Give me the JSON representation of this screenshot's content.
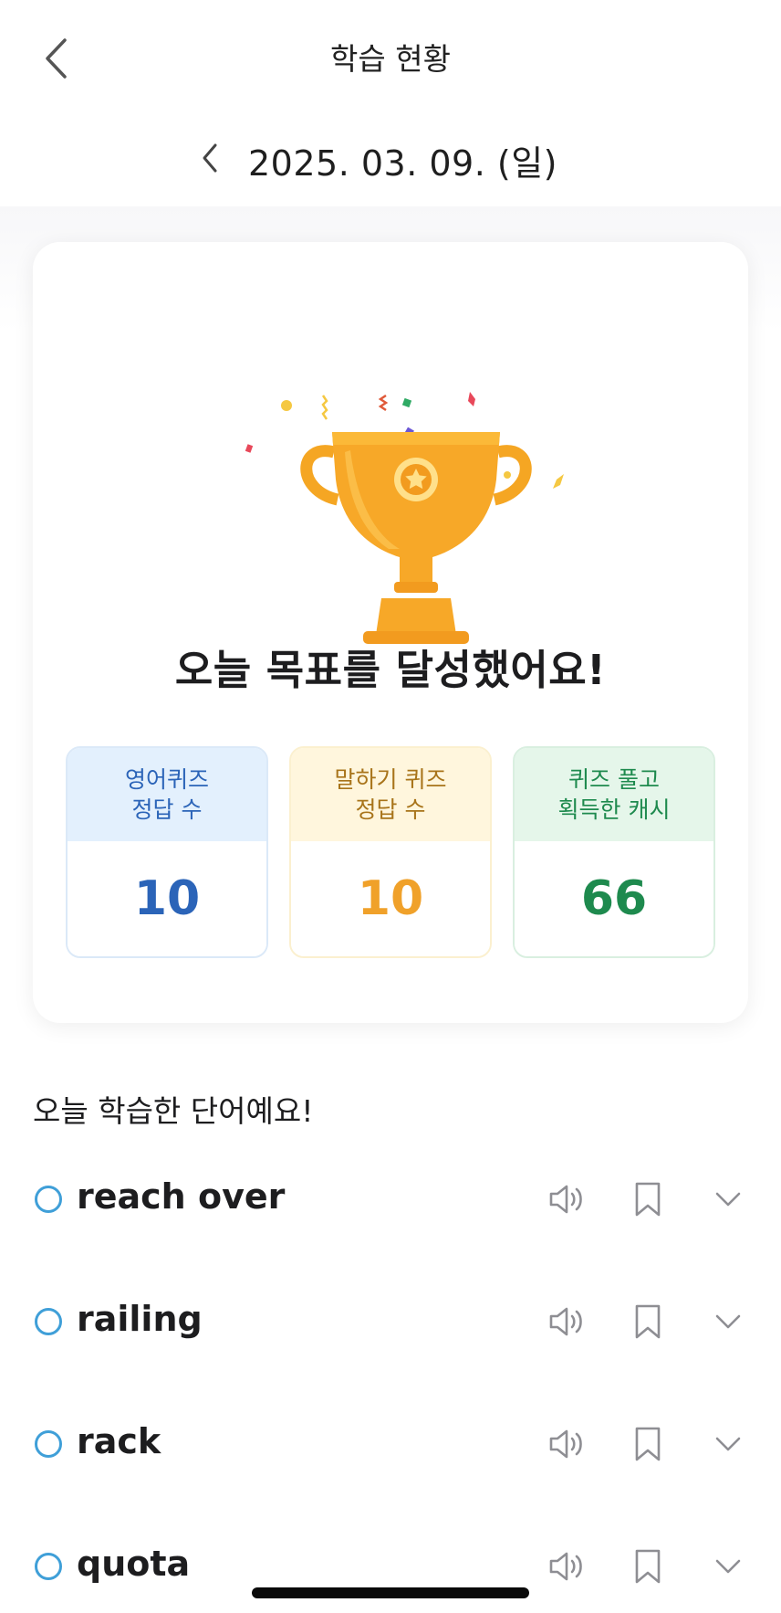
{
  "header": {
    "title": "학습 현황",
    "back_icon": "chevron-left-icon"
  },
  "date_nav": {
    "date": "2025. 03. 09. (일)",
    "prev_icon": "chevron-left-icon"
  },
  "summary": {
    "goal_message": "오늘 목표를 달성했어요!",
    "trophy_icon": "trophy-icon",
    "stats": [
      {
        "label_line1": "영어퀴즈",
        "label_line2": "정답 수",
        "value": "10",
        "accent": "#2b64b8",
        "header_bg": "#e3f0fd",
        "border": "#dbe9f8"
      },
      {
        "label_line1": "말하기 퀴즈",
        "label_line2": "정답 수",
        "value": "10",
        "accent": "#f0a12a",
        "header_bg": "#fff6dd",
        "border": "#fbf0cf"
      },
      {
        "label_line1": "퀴즈 풀고",
        "label_line2": "획득한 캐시",
        "value": "66",
        "accent": "#1e8a4e",
        "header_bg": "#e5f6ea",
        "border": "#d9efe0"
      }
    ]
  },
  "words_section": {
    "title": "오늘 학습한 단어예요!",
    "words": [
      {
        "text": "reach over"
      },
      {
        "text": "railing"
      },
      {
        "text": "rack"
      },
      {
        "text": "quota"
      }
    ],
    "icons": {
      "speaker": "speaker-icon",
      "bookmark": "bookmark-icon",
      "expand": "chevron-down-icon"
    }
  },
  "colors": {
    "check_ring": "#3f9fd8",
    "icon_gray": "#8e8e93"
  }
}
